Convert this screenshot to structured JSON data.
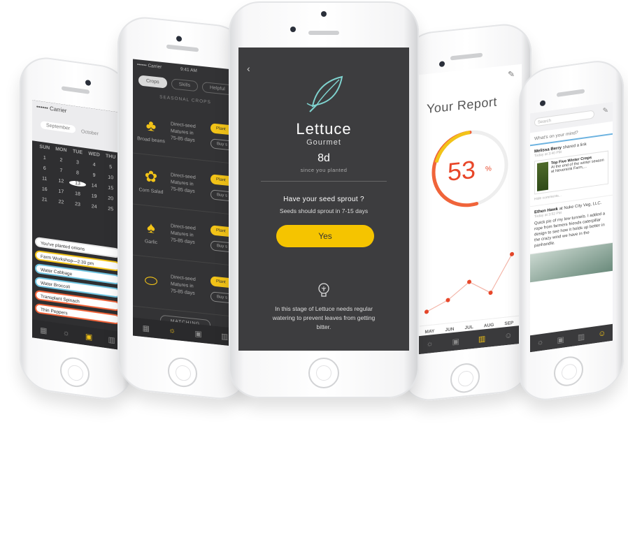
{
  "calendar_phone": {
    "status": "•••••• Carrier",
    "month_selected": "September",
    "month_next": "October",
    "month_next2": "November",
    "day_headers": [
      "SUN",
      "MON",
      "TUE",
      "WED",
      "THU"
    ],
    "days": [
      "1",
      "2",
      "3",
      "4",
      "5",
      "6",
      "7",
      "8",
      "9",
      "10",
      "11",
      "12",
      "13",
      "14",
      "15",
      "16",
      "17",
      "18",
      "19",
      "20",
      "21",
      "22",
      "23",
      "24",
      "25"
    ],
    "today": "13",
    "events": [
      "You've planted onions",
      "Farm Workshop—2:30 pm",
      "Water Cabbage",
      "Water Broccoli",
      "Transplant Spinach",
      "Thin Peppers"
    ]
  },
  "crops_phone": {
    "status": "•••••• Carrier",
    "time": "9:41 AM",
    "tabs": [
      "Crops",
      "Skills",
      "Helpful"
    ],
    "section": "SEASONAL CROPS",
    "crops": [
      {
        "name": "Broad beans",
        "info1": "Direct-seed",
        "info2": "Matures in",
        "info3": "75-85 days",
        "plant": "Plant",
        "buy": "Buy s"
      },
      {
        "name": "Corn Salad",
        "info1": "Direct-seed",
        "info2": "Matures in",
        "info3": "75-85 days",
        "plant": "Plant",
        "buy": "Buy s"
      },
      {
        "name": "Garlic",
        "info1": "Direct-seed",
        "info2": "Matures in",
        "info3": "75-85 days",
        "plant": "Plant",
        "buy": "Buy s"
      },
      {
        "name": "",
        "info1": "Direct-seed",
        "info2": "Matures in",
        "info3": "75-85 days",
        "plant": "Plant",
        "buy": "Buy s"
      }
    ],
    "matching": "MATCHING"
  },
  "center_phone": {
    "back": "‹",
    "plant_name": "Lettuce",
    "variety": "Gourmet",
    "days": "8d",
    "since": "since you planted",
    "question": "Have your seed sprout ?",
    "hint": "Seeds should sprout in 7-15 days",
    "yes_button": "Yes",
    "tip": "In this stage of Lettuce needs regular watering to prevent leaves from getting bitter."
  },
  "report_phone": {
    "title": "Your Report",
    "percent": "53",
    "percent_symbol": "%",
    "progress": 0.53,
    "months": [
      "MAY",
      "JUN",
      "JUL",
      "AUG",
      "SEP"
    ],
    "points": [
      0.15,
      0.28,
      0.5,
      0.32,
      0.82
    ],
    "colors": {
      "ring": "#f0643a",
      "accent": "#f2c318",
      "line": "#e8e8e8"
    }
  },
  "feed_phone": {
    "search_placeholder": "Search",
    "prompt": "What's on your mind?",
    "post1_author": "Melissa Berry",
    "post1_action": "shared a link",
    "post1_time": "Today at 3:40 PM",
    "card_title": "Top Five Winter Crops",
    "card_text": "At the end of the winter season at Neversink Farm,...",
    "more": "Hide comments...",
    "post2_author": "Ethen Hawk",
    "post2_action": "at Nuke City Veg, LLC.",
    "post2_time": "Today at 3:52 PM",
    "post2_text": "Quick pic of my low tunnels. I added a rope from farmers friends caterpillar design to see how it holds up better in the crazy wind we have in the panhandle."
  }
}
